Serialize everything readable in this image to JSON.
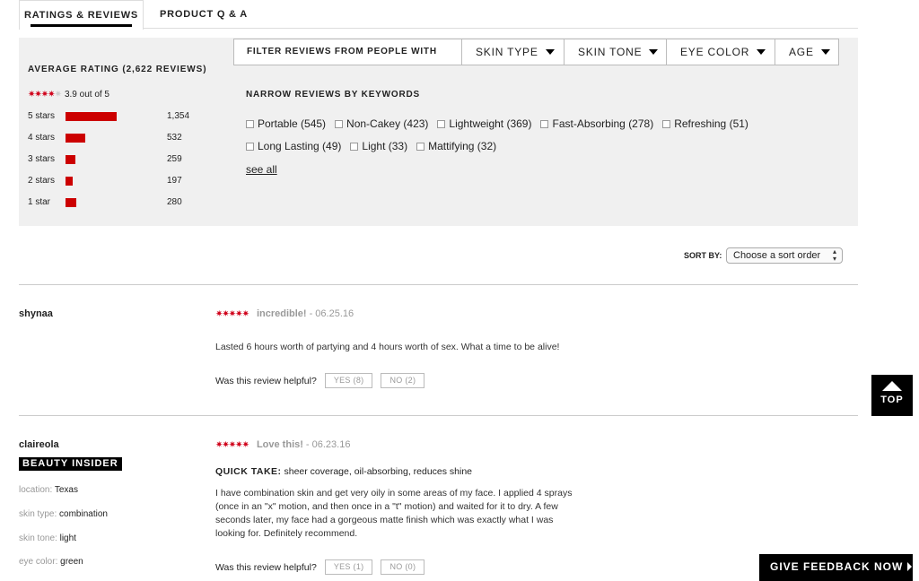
{
  "tabs": {
    "ratings": "RATINGS & REVIEWS",
    "qa": "PRODUCT Q & A"
  },
  "summary": {
    "title": "AVERAGE RATING (2,622 REVIEWS)",
    "rating": 3.9,
    "rating_text": "3.9 out of 5",
    "histogram": [
      {
        "label": "5 stars",
        "count": "1,354",
        "fraction": 0.516
      },
      {
        "label": "4 stars",
        "count": "532",
        "fraction": 0.203
      },
      {
        "label": "3 stars",
        "count": "259",
        "fraction": 0.099
      },
      {
        "label": "2 stars",
        "count": "197",
        "fraction": 0.075
      },
      {
        "label": "1 star",
        "count": "280",
        "fraction": 0.107
      }
    ],
    "bar_color": "#cc0000"
  },
  "filter": {
    "label": "FILTER REVIEWS FROM PEOPLE WITH",
    "dropdowns": [
      "SKIN TYPE",
      "SKIN TONE",
      "EYE COLOR",
      "AGE"
    ]
  },
  "keywords": {
    "title": "NARROW REVIEWS BY KEYWORDS",
    "row1": [
      "Portable (545)",
      "Non-Cakey (423)",
      "Lightweight (369)",
      "Fast-Absorbing (278)",
      "Refreshing (51)"
    ],
    "row2": [
      "Long Lasting (49)",
      "Light (33)",
      "Mattifying (32)"
    ],
    "see_all": "see all"
  },
  "sort": {
    "label": "SORT BY:",
    "value": "Choose a sort order"
  },
  "reviews": [
    {
      "user": "shynaa",
      "stars": 5,
      "title": "incredible!",
      "date": "- 06.25.16",
      "body": "Lasted 6 hours worth of partying and 4 hours worth of sex. What a time to be alive!",
      "helpful_q": "Was this review helpful?",
      "yes": "YES (8)",
      "no": "NO (2)"
    },
    {
      "user": "claireola",
      "badge": "BEAUTY INSIDER",
      "meta": [
        {
          "k": "location:",
          "v": "Texas"
        },
        {
          "k": "skin type:",
          "v": "combination"
        },
        {
          "k": "skin tone:",
          "v": "light"
        },
        {
          "k": "eye color:",
          "v": "green"
        }
      ],
      "stars": 5,
      "title": "Love this!",
      "date": "- 06.23.16",
      "quick_take_label": "QUICK TAKE:",
      "quick_take": "sheer coverage, oil-absorbing, reduces shine",
      "body": "I have combination skin and get very oily in some areas of my face. I applied 4 sprays (once in an \"x\" motion, and then once in a \"t\" motion) and waited for it to dry. A few seconds later, my face had a gorgeous matte finish which was exactly what I was looking for. Definitely recommend.",
      "helpful_q": "Was this review helpful?",
      "yes": "YES (1)",
      "no": "NO (0)"
    }
  ],
  "top_button": "TOP",
  "feedback_button": "GIVE FEEDBACK NOW"
}
